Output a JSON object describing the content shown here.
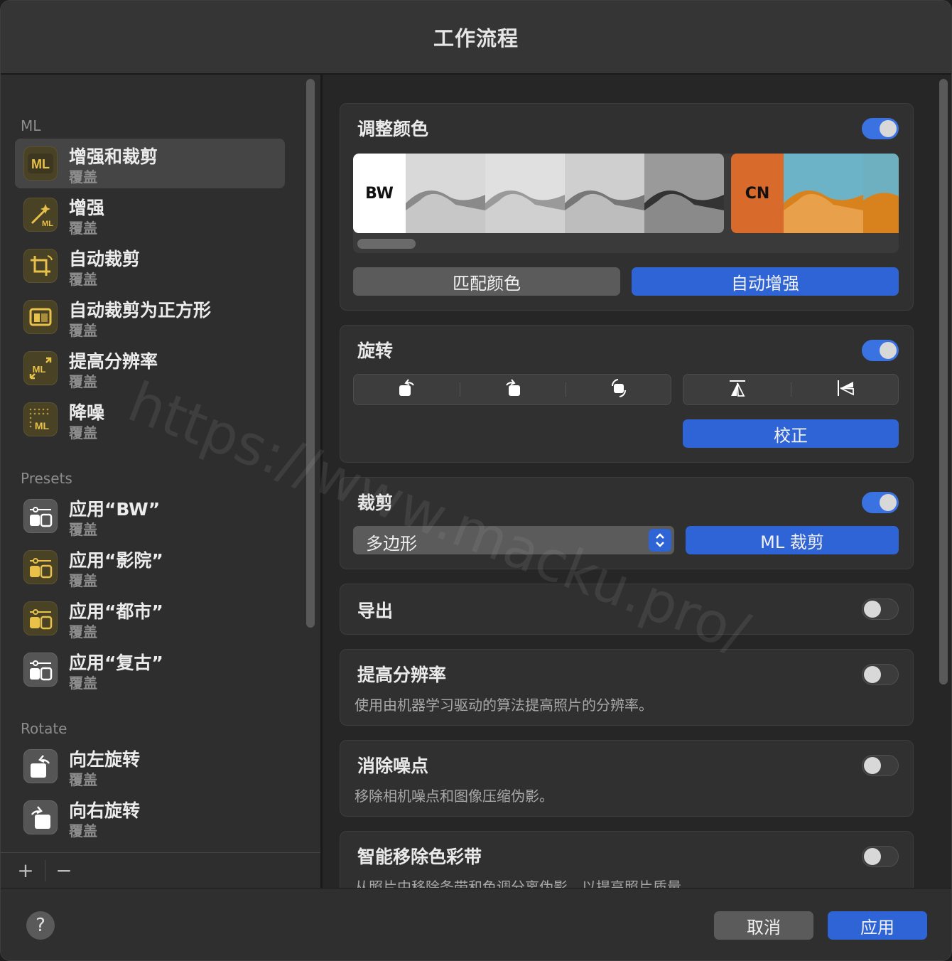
{
  "window": {
    "title": "工作流程"
  },
  "sidebar": {
    "sections": [
      {
        "label": "ML",
        "items": [
          {
            "name": "增强和裁剪",
            "sub": "覆盖",
            "icon": "ml-badge-icon"
          },
          {
            "name": "增强",
            "sub": "覆盖",
            "icon": "magic-wand-ml-icon"
          },
          {
            "name": "自动裁剪",
            "sub": "覆盖",
            "icon": "auto-crop-icon"
          },
          {
            "name": "自动裁剪为正方形",
            "sub": "覆盖",
            "icon": "crop-square-icon"
          },
          {
            "name": "提高分辨率",
            "sub": "覆盖",
            "icon": "upscale-ml-icon"
          },
          {
            "name": "降噪",
            "sub": "覆盖",
            "icon": "denoise-ml-icon"
          }
        ]
      },
      {
        "label": "Presets",
        "items": [
          {
            "name": "应用“BW”",
            "sub": "覆盖",
            "icon": "preset-icon"
          },
          {
            "name": "应用“影院”",
            "sub": "覆盖",
            "icon": "preset-icon"
          },
          {
            "name": "应用“都市”",
            "sub": "覆盖",
            "icon": "preset-icon"
          },
          {
            "name": "应用“复古”",
            "sub": "覆盖",
            "icon": "preset-icon"
          }
        ]
      },
      {
        "label": "Rotate",
        "items": [
          {
            "name": "向左旋转",
            "sub": "覆盖",
            "icon": "rotate-left-icon"
          },
          {
            "name": "向右旋转",
            "sub": "覆盖",
            "icon": "rotate-right-icon"
          }
        ]
      }
    ],
    "footer": {
      "add": "+",
      "remove": "−"
    }
  },
  "main": {
    "adjust_color": {
      "title": "调整颜色",
      "enabled": true,
      "preset_bw": "BW",
      "preset_cn": "CN",
      "match_btn": "匹配颜色",
      "auto_btn": "自动增强"
    },
    "rotate": {
      "title": "旋转",
      "enabled": true,
      "straighten_btn": "校正"
    },
    "crop": {
      "title": "裁剪",
      "enabled": true,
      "shape_value": "多边形",
      "ml_btn": "ML 裁剪"
    },
    "export": {
      "title": "导出",
      "enabled": false
    },
    "upscale": {
      "title": "提高分辨率",
      "enabled": false,
      "desc": "使用由机器学习驱动的算法提高照片的分辨率。"
    },
    "denoise": {
      "title": "消除噪点",
      "enabled": false,
      "desc": "移除相机噪点和图像压缩伪影。"
    },
    "deband": {
      "title": "智能移除色彩带",
      "enabled": false,
      "desc": "从照片中移除条带和色调分离伪影，以提高照片质量。"
    }
  },
  "bottom": {
    "help": "?",
    "cancel": "取消",
    "apply": "应用"
  },
  "watermark": "https://www.macku.pro/",
  "colors": {
    "accent": "#2f64d6",
    "toggle_on": "#3a72e2",
    "ml_gold": "#e8c14a",
    "cn_orange": "#d86a2c"
  }
}
